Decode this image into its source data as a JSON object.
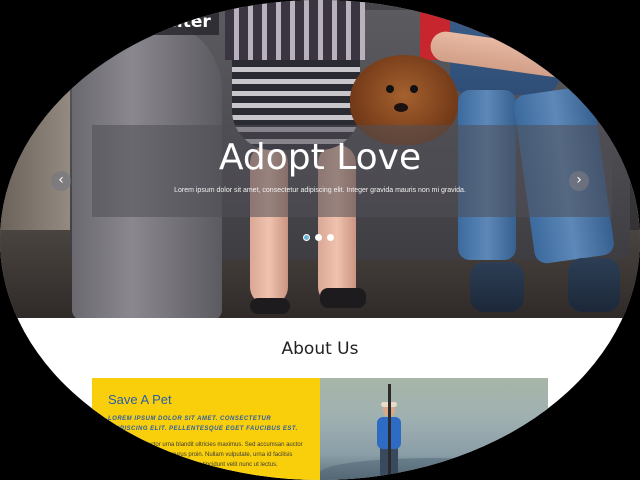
{
  "header": {
    "logo_text": "Pet Shelter",
    "menu_icon": "hamburger-menu-icon"
  },
  "hero": {
    "title": "Adopt Love",
    "text": "Lorem ipsum dolor sit amet, consectetur adipiscing elit. Integer gravida mauris non mi gravida.",
    "prev_arrow": "‹",
    "next_arrow": "›",
    "slides": 3,
    "active_slide": 1
  },
  "about": {
    "title": "About Us",
    "card": {
      "title": "Save A Pet",
      "subtitle": "LOREM IPSUM DOLOR SIT AMET. CONSECTETUR ADIPISCING ELIT. PELLENTESQUE EGET FAUCIBUS EST.",
      "body": "Suspendisse auctor urna blandit ultricies maximus. Sed accumsan auctor lacus ac mattis. Nam id purus proin. Nullam vulputate, urna id facilisis eleifend, nisl imperdiet augue, eget tincidunt velit nunc ut lectus."
    }
  },
  "colors": {
    "accent_yellow": "#f9cf0b",
    "title_blue": "#2a5da8",
    "active_dot": "#6fb3d6"
  }
}
